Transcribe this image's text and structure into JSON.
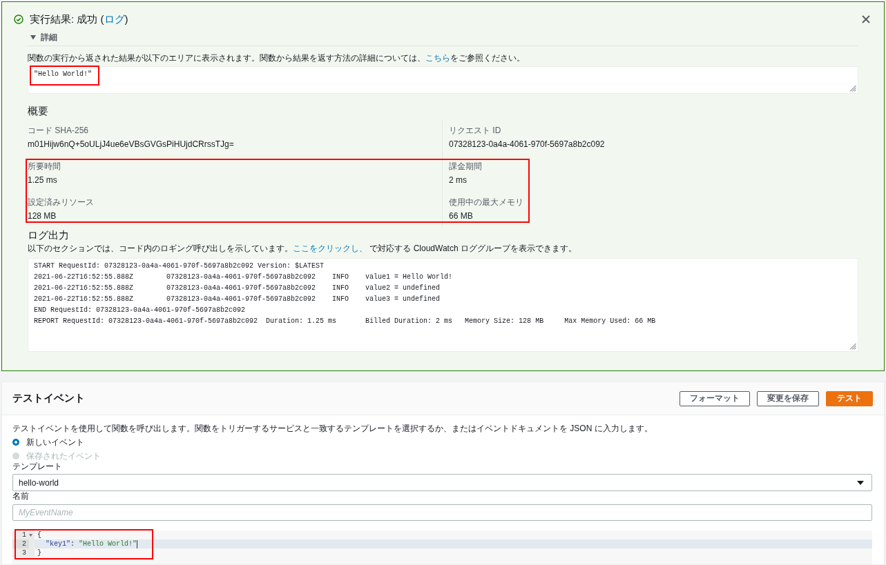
{
  "result": {
    "succeeded": true,
    "title": {
      "before": "実行結果: 成功 (",
      "link": "ログ",
      "after": ")"
    },
    "details": {
      "label": "詳細",
      "expanded": true,
      "description": {
        "before": "関数の実行から返された結果が以下のエリアに表示されます。関数から結果を返す方法の詳細については、",
        "link": "こちら",
        "after": "をご参照ください。"
      },
      "output": {
        "value": "\"Hello World!\"",
        "highlighted": true
      },
      "summary": {
        "title": "概要",
        "groups": [
          {
            "highlighted": false,
            "fields": [
              {
                "label": "コード SHA-256",
                "value": "m01Hijw6nQ+5oULjJ4ue6eVBsGVGsPiHUjdCRrssTJg="
              },
              {
                "label": "リクエスト ID",
                "value": "07328123-0a4a-4061-970f-5697a8b2c092"
              }
            ]
          },
          {
            "highlighted": true,
            "fields": [
              {
                "label": "所要時間",
                "value": "1.25 ms"
              },
              {
                "label": "課金期間",
                "value": "2 ms"
              },
              {
                "label": "設定済みリソース",
                "value": "128 MB"
              },
              {
                "label": "使用中の最大メモリ",
                "value": "66 MB"
              }
            ]
          }
        ]
      },
      "log": {
        "title": "ログ出力",
        "description": {
          "before": "以下のセクションでは、コード内のロギング呼び出しを示しています。",
          "link": "ここをクリックし、",
          "after": " で対応する CloudWatch ロググループを表示できます。"
        },
        "lines": [
          "START RequestId: 07328123-0a4a-4061-970f-5697a8b2c092 Version: $LATEST",
          "2021-06-22T16:52:55.888Z\t07328123-0a4a-4061-970f-5697a8b2c092\tINFO\tvalue1 = Hello World!",
          "2021-06-22T16:52:55.888Z\t07328123-0a4a-4061-970f-5697a8b2c092\tINFO\tvalue2 = undefined",
          "2021-06-22T16:52:55.888Z\t07328123-0a4a-4061-970f-5697a8b2c092\tINFO\tvalue3 = undefined",
          "END RequestId: 07328123-0a4a-4061-970f-5697a8b2c092",
          "REPORT RequestId: 07328123-0a4a-4061-970f-5697a8b2c092\tDuration: 1.25 ms\tBilled Duration: 2 ms\tMemory Size: 128 MB\tMax Memory Used: 66 MB"
        ]
      }
    }
  },
  "test_event": {
    "title": "テストイベント",
    "buttons": [
      {
        "label": "フォーマット",
        "kind": "normal"
      },
      {
        "label": "変更を保存",
        "kind": "normal"
      },
      {
        "label": "テスト",
        "kind": "primary"
      }
    ],
    "description": "テストイベントを使用して関数を呼び出します。関数をトリガーするサービスと一致するテンプレートを選択するか、またはイベントドキュメントを JSON に入力します。",
    "event_options": [
      {
        "label": "新しいイベント",
        "selected": true,
        "disabled": false
      },
      {
        "label": "保存されたイベント",
        "selected": false,
        "disabled": true
      }
    ],
    "template": {
      "label": "テンプレート",
      "value": "hello-world"
    },
    "name": {
      "label": "名前",
      "placeholder": "MyEventName"
    },
    "editor": {
      "highlighted": true,
      "lines": [
        {
          "number": "1",
          "foldable": true,
          "active": false,
          "tokens": [
            {
              "kind": "punct",
              "text": "{"
            }
          ]
        },
        {
          "number": "2",
          "foldable": false,
          "active": true,
          "tokens": [
            {
              "kind": "key",
              "text": "  \"key1\""
            },
            {
              "kind": "punct",
              "text": ": "
            },
            {
              "kind": "string",
              "text": "\"Hello World!\""
            }
          ]
        },
        {
          "number": "3",
          "foldable": false,
          "active": false,
          "tokens": [
            {
              "kind": "punct",
              "text": "}"
            }
          ]
        }
      ]
    }
  }
}
